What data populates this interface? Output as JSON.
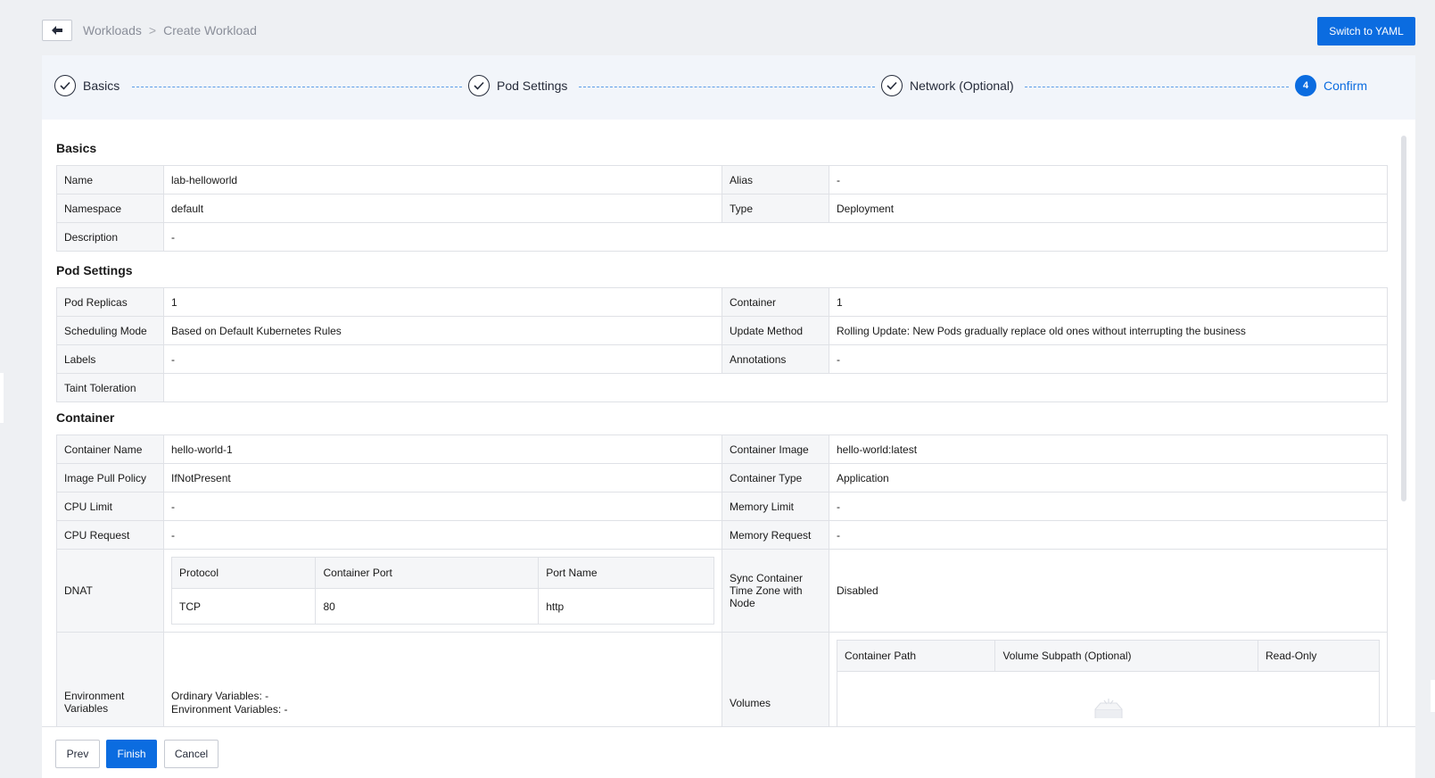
{
  "header": {
    "breadcrumb": [
      "Workloads",
      ">",
      "Create Workload"
    ],
    "switch_yaml": "Switch to YAML"
  },
  "steps": [
    {
      "label": "Basics",
      "state": "done"
    },
    {
      "label": "Pod Settings",
      "state": "done"
    },
    {
      "label": "Network (Optional)",
      "state": "done"
    },
    {
      "label": "Confirm",
      "state": "active",
      "number": "4"
    }
  ],
  "sections": {
    "basics": {
      "title": "Basics",
      "name_label": "Name",
      "name_value": "lab-helloworld",
      "alias_label": "Alias",
      "alias_value": "-",
      "namespace_label": "Namespace",
      "namespace_value": "default",
      "type_label": "Type",
      "type_value": "Deployment",
      "description_label": "Description",
      "description_value": "-"
    },
    "pod": {
      "title": "Pod Settings",
      "replicas_label": "Pod Replicas",
      "replicas_value": "1",
      "container_label": "Container",
      "container_value": "1",
      "scheduling_label": "Scheduling Mode",
      "scheduling_value": "Based on Default Kubernetes Rules",
      "update_label": "Update Method",
      "update_value": "Rolling Update: New Pods gradually replace old ones without interrupting the business",
      "labels_label": "Labels",
      "labels_value": "-",
      "annotations_label": "Annotations",
      "annotations_value": "-",
      "taint_label": "Taint Toleration",
      "taint_value": ""
    },
    "container": {
      "title": "Container",
      "name_label": "Container Name",
      "name_value": "hello-world-1",
      "image_label": "Container Image",
      "image_value": "hello-world:latest",
      "pull_label": "Image Pull Policy",
      "pull_value": "IfNotPresent",
      "ctype_label": "Container Type",
      "ctype_value": "Application",
      "cpu_limit_label": "CPU Limit",
      "cpu_limit_value": "-",
      "mem_limit_label": "Memory Limit",
      "mem_limit_value": "-",
      "cpu_req_label": "CPU Request",
      "cpu_req_value": "-",
      "mem_req_label": "Memory Request",
      "mem_req_value": "-",
      "dnat_label": "DNAT",
      "dnat_headers": [
        "Protocol",
        "Container Port",
        "Port Name"
      ],
      "dnat_rows": [
        [
          "TCP",
          "80",
          "http"
        ]
      ],
      "sync_label": "Sync Container Time Zone with Node",
      "sync_value": "Disabled",
      "env_label": "Environment Variables",
      "env_ordinary": "Ordinary Variables: -",
      "env_env": "Environment Variables: -",
      "volumes_label": "Volumes",
      "volume_headers": [
        "Container Path",
        "Volume Subpath (Optional)",
        "Read-Only"
      ]
    }
  },
  "footer": {
    "prev": "Prev",
    "finish": "Finish",
    "cancel": "Cancel"
  }
}
